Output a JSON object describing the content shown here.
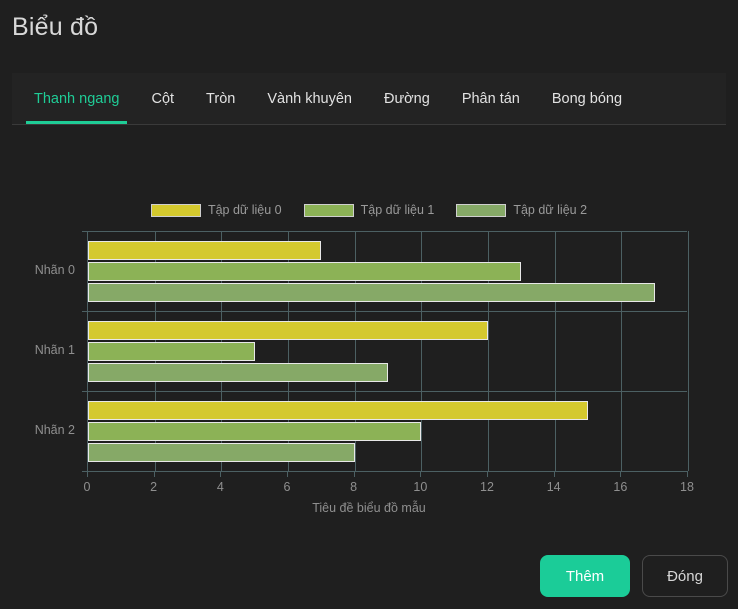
{
  "dialog": {
    "title": "Biểu đồ"
  },
  "tabs": [
    {
      "label": "Thanh ngang",
      "active": true
    },
    {
      "label": "Cột",
      "active": false
    },
    {
      "label": "Tròn",
      "active": false
    },
    {
      "label": "Vành khuyên",
      "active": false
    },
    {
      "label": "Đường",
      "active": false
    },
    {
      "label": "Phân tán",
      "active": false
    },
    {
      "label": "Bong bóng",
      "active": false
    }
  ],
  "footer": {
    "primary_label": "Thêm",
    "secondary_label": "Đóng"
  },
  "colors": {
    "accent": "#1fcc96",
    "primary_button": "#1bcc98",
    "series_0": "#d4c92e",
    "series_1": "#8cb256",
    "series_2": "#86a967",
    "grid": "#4c6063",
    "background": "#1f1f1f",
    "tabbar_background": "#232323"
  },
  "chart_data": {
    "type": "bar",
    "orientation": "horizontal",
    "title": "",
    "xlabel": "Tiêu đề biểu đồ mẫu",
    "ylabel": "",
    "categories": [
      "Nhãn 0",
      "Nhãn 1",
      "Nhãn 2"
    ],
    "series": [
      {
        "name": "Tập dữ liệu 0",
        "color": "#d4c92e",
        "values": [
          7,
          12,
          15
        ]
      },
      {
        "name": "Tập dữ liệu 1",
        "color": "#8cb256",
        "values": [
          13,
          5,
          10
        ]
      },
      {
        "name": "Tập dữ liệu 2",
        "color": "#86a967",
        "values": [
          17,
          9,
          8
        ]
      }
    ],
    "xlim": [
      0,
      18
    ],
    "xticks": [
      0,
      2,
      4,
      6,
      8,
      10,
      12,
      14,
      16,
      18
    ],
    "grid": true,
    "legend": "top"
  }
}
